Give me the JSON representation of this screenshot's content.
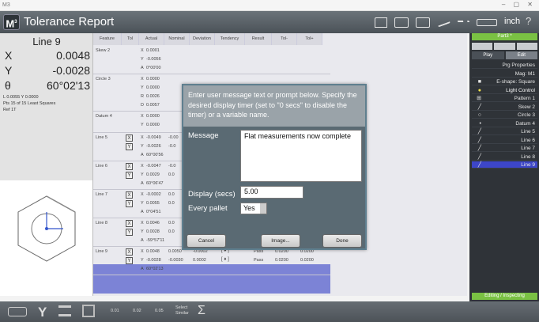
{
  "window": {
    "mark": "M3",
    "controls": "– ▢ ✕"
  },
  "header": {
    "logo": "M",
    "logo_sup": "3",
    "title": "Tolerance Report",
    "units": "inch",
    "help": "?"
  },
  "readout": {
    "feature": "Line 9",
    "x_label": "X",
    "x_value": "0.0048",
    "y_label": "Y",
    "y_value": "-0.0028",
    "theta_label": "θ",
    "theta_value": "60°02'13",
    "small1": "L 0.0055    Y 0.0000",
    "small2": "Pts 15 of 15    Least Squares",
    "small3": "Ref 1T"
  },
  "grid": {
    "headers": [
      "Feature",
      "Tol",
      "Actual",
      "Nominal",
      "Deviation",
      "Tendency",
      "Result",
      "Tol-",
      "Tol+"
    ],
    "rows": [
      {
        "feature": "Skew 2",
        "lines": [
          {
            "k": "X",
            "v": "0.0001"
          },
          {
            "k": "Y",
            "v": "-0.0056"
          },
          {
            "k": "A",
            "v": "0°00'00"
          }
        ]
      },
      {
        "feature": "Circle 3",
        "lines": [
          {
            "k": "X",
            "v": "0.0000"
          },
          {
            "k": "Y",
            "v": "0.0000"
          },
          {
            "k": "R",
            "v": "0.0026"
          },
          {
            "k": "D",
            "v": "0.0057"
          }
        ]
      },
      {
        "feature": "Datum 4",
        "lines": [
          {
            "k": "X",
            "v": "0.0000"
          },
          {
            "k": "Y",
            "v": "0.0000"
          }
        ]
      },
      {
        "feature": "Line 5",
        "lines": [
          {
            "k": "X",
            "v": "-0.0049",
            "n": "-0.00"
          },
          {
            "k": "Y",
            "v": "-0.0026",
            "n": "-0.0"
          },
          {
            "k": "A",
            "v": "60°00'56"
          }
        ]
      },
      {
        "feature": "Line 6",
        "lines": [
          {
            "k": "X",
            "v": "-0.0047",
            "n": "-0.0"
          },
          {
            "k": "Y",
            "v": "0.0029",
            "n": "0.0"
          },
          {
            "k": "A",
            "v": "60°06'47"
          }
        ]
      },
      {
        "feature": "Line 7",
        "lines": [
          {
            "k": "X",
            "v": "-0.0002",
            "n": "0.0"
          },
          {
            "k": "Y",
            "v": "0.0055",
            "n": "0.0"
          },
          {
            "k": "A",
            "v": "0°04'51"
          }
        ]
      },
      {
        "feature": "Line 8",
        "lines": [
          {
            "k": "X",
            "v": "0.0046",
            "n": "0.0"
          },
          {
            "k": "Y",
            "v": "0.0028",
            "n": "0.0"
          },
          {
            "k": "A",
            "v": "-59°57'11"
          }
        ]
      },
      {
        "feature": "Line 9",
        "lines": [
          {
            "k": "X",
            "v": "0.0048",
            "n": "0.0050",
            "d": "-0.0002",
            "r": "Pass",
            "tm": "0.0200",
            "tp": "0.0200"
          },
          {
            "k": "Y",
            "v": "-0.0028",
            "n": "-0.0030",
            "d": "0.0002",
            "r": "Pass",
            "tm": "0.0200",
            "tp": "0.0200"
          },
          {
            "k": "A",
            "v": "60°02'13"
          }
        ]
      }
    ]
  },
  "right_panel": {
    "part": "Part3 *",
    "tabs": [
      "Play",
      "Edit"
    ],
    "items": [
      "Prg Properties",
      "Mag: M1",
      "E-shape: Square",
      "Light Control",
      "Pattern 1",
      "Skew 2",
      "Circle 3",
      "Datum 4",
      "Line 5",
      "Line 6",
      "Line 7",
      "Line 8",
      "Line 9"
    ],
    "status": "Editing / Inspecting"
  },
  "bottom": {
    "t1": "0.01",
    "t2": "0.02",
    "t3": "0.05",
    "t4": "Select",
    "t5": "Similar",
    "sigma": "Σ"
  },
  "modal": {
    "prompt": "Enter user message text or prompt below. Specify the desired display timer (set to \"0 secs\" to disable the timer) or a variable name.",
    "message_label": "Message",
    "message_value": "Flat measurements now complete",
    "display_label": "Display (secs)",
    "display_value": "5.00",
    "pallet_label": "Every pallet",
    "pallet_value": "Yes",
    "cancel": "Cancel",
    "image": "Image...",
    "done": "Done"
  }
}
